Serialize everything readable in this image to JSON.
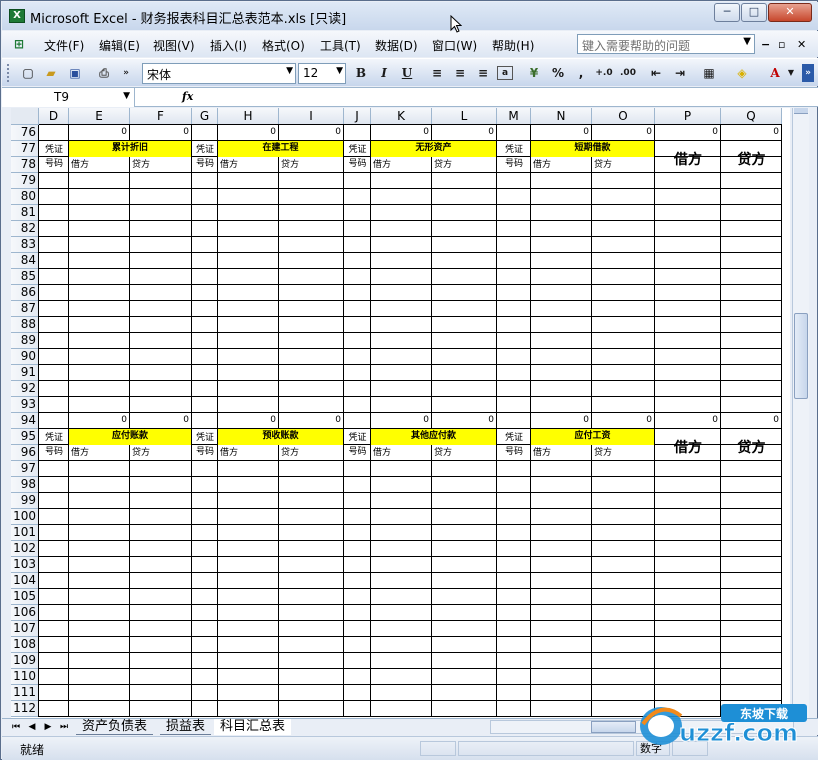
{
  "window": {
    "title": "Microsoft Excel - 财务报表科目汇总表范本.xls  [只读]",
    "app_icon": "excel-icon",
    "buttons": {
      "minimize": "─",
      "maximize": "□",
      "close": "✕"
    }
  },
  "menu": {
    "items": [
      "文件(F)",
      "编辑(E)",
      "视图(V)",
      "插入(I)",
      "格式(O)",
      "工具(T)",
      "数据(D)",
      "窗口(W)",
      "帮助(H)"
    ],
    "help_placeholder": "键入需要帮助的问题",
    "mdi_buttons": [
      "−",
      "▫",
      "✕"
    ]
  },
  "toolbar": {
    "font_name": "宋体",
    "font_size": "12",
    "bold": "B",
    "italic": "I",
    "underline": "U",
    "percent": "%",
    "comma": ",",
    "inc_decimal": "+.0",
    "dec_decimal": ".00",
    "font_color_label": "A",
    "icons": [
      "new-icon",
      "open-icon",
      "save-icon",
      "print-icon",
      "chevron-icon",
      "align-left-icon",
      "align-center-icon",
      "align-right-icon",
      "merge-center-icon",
      "currency-icon",
      "indent-decrease-icon",
      "indent-increase-icon",
      "borders-icon",
      "fill-color-icon",
      "font-color-icon"
    ]
  },
  "formula_bar": {
    "name_box": "T9",
    "fx": "fx",
    "value": ""
  },
  "sheet": {
    "columns": [
      "D",
      "E",
      "F",
      "G",
      "H",
      "I",
      "J",
      "K",
      "L",
      "M",
      "N",
      "O",
      "P",
      "Q"
    ],
    "rows": [
      "76",
      "77",
      "78",
      "79",
      "80",
      "81",
      "82",
      "83",
      "84",
      "85",
      "86",
      "87",
      "88",
      "89",
      "90",
      "91",
      "92",
      "93",
      "94",
      "95",
      "96",
      "97",
      "98",
      "99",
      "100",
      "101",
      "102",
      "103",
      "104",
      "105",
      "106",
      "107",
      "108",
      "109",
      "110",
      "111",
      "112"
    ],
    "zero": "0",
    "voucher_top": "凭证",
    "voucher_bottom": "号码",
    "debit_small": "借方",
    "credit_small": "贷方",
    "debit_big": "借方",
    "credit_big": "贷方",
    "section1_titles": [
      "累计折旧",
      "在建工程",
      "无形资产",
      "短期借款"
    ],
    "section2_titles": [
      "应付账款",
      "预收账款",
      "其他应付款",
      "应付工资"
    ]
  },
  "tabs": {
    "nav": [
      "⏮",
      "◀",
      "▶",
      "⏭"
    ],
    "sheets": [
      "资产负债表",
      "损益表",
      "科目汇总表"
    ],
    "active_index": 2
  },
  "status": {
    "ready": "就绪",
    "num_indicator": "数字"
  },
  "watermark": {
    "brand": "uzzf.com",
    "badge": "东坡下载"
  },
  "colors": {
    "header_yellow": "#ffff00",
    "grid_border": "#000000",
    "header_blue": "#9eb6ce"
  }
}
